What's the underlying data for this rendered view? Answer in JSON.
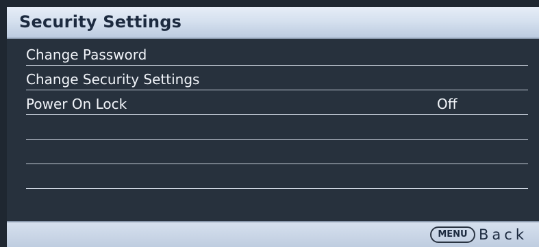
{
  "panel": {
    "title": "Security Settings"
  },
  "menu": {
    "items": [
      {
        "label": "Change Password",
        "value": ""
      },
      {
        "label": "Change Security Settings",
        "value": ""
      },
      {
        "label": "Power On Lock",
        "value": "Off"
      },
      {
        "label": "",
        "value": ""
      },
      {
        "label": "",
        "value": ""
      },
      {
        "label": "",
        "value": ""
      }
    ]
  },
  "footer": {
    "menu_key": "MENU",
    "back_label": "Back"
  }
}
